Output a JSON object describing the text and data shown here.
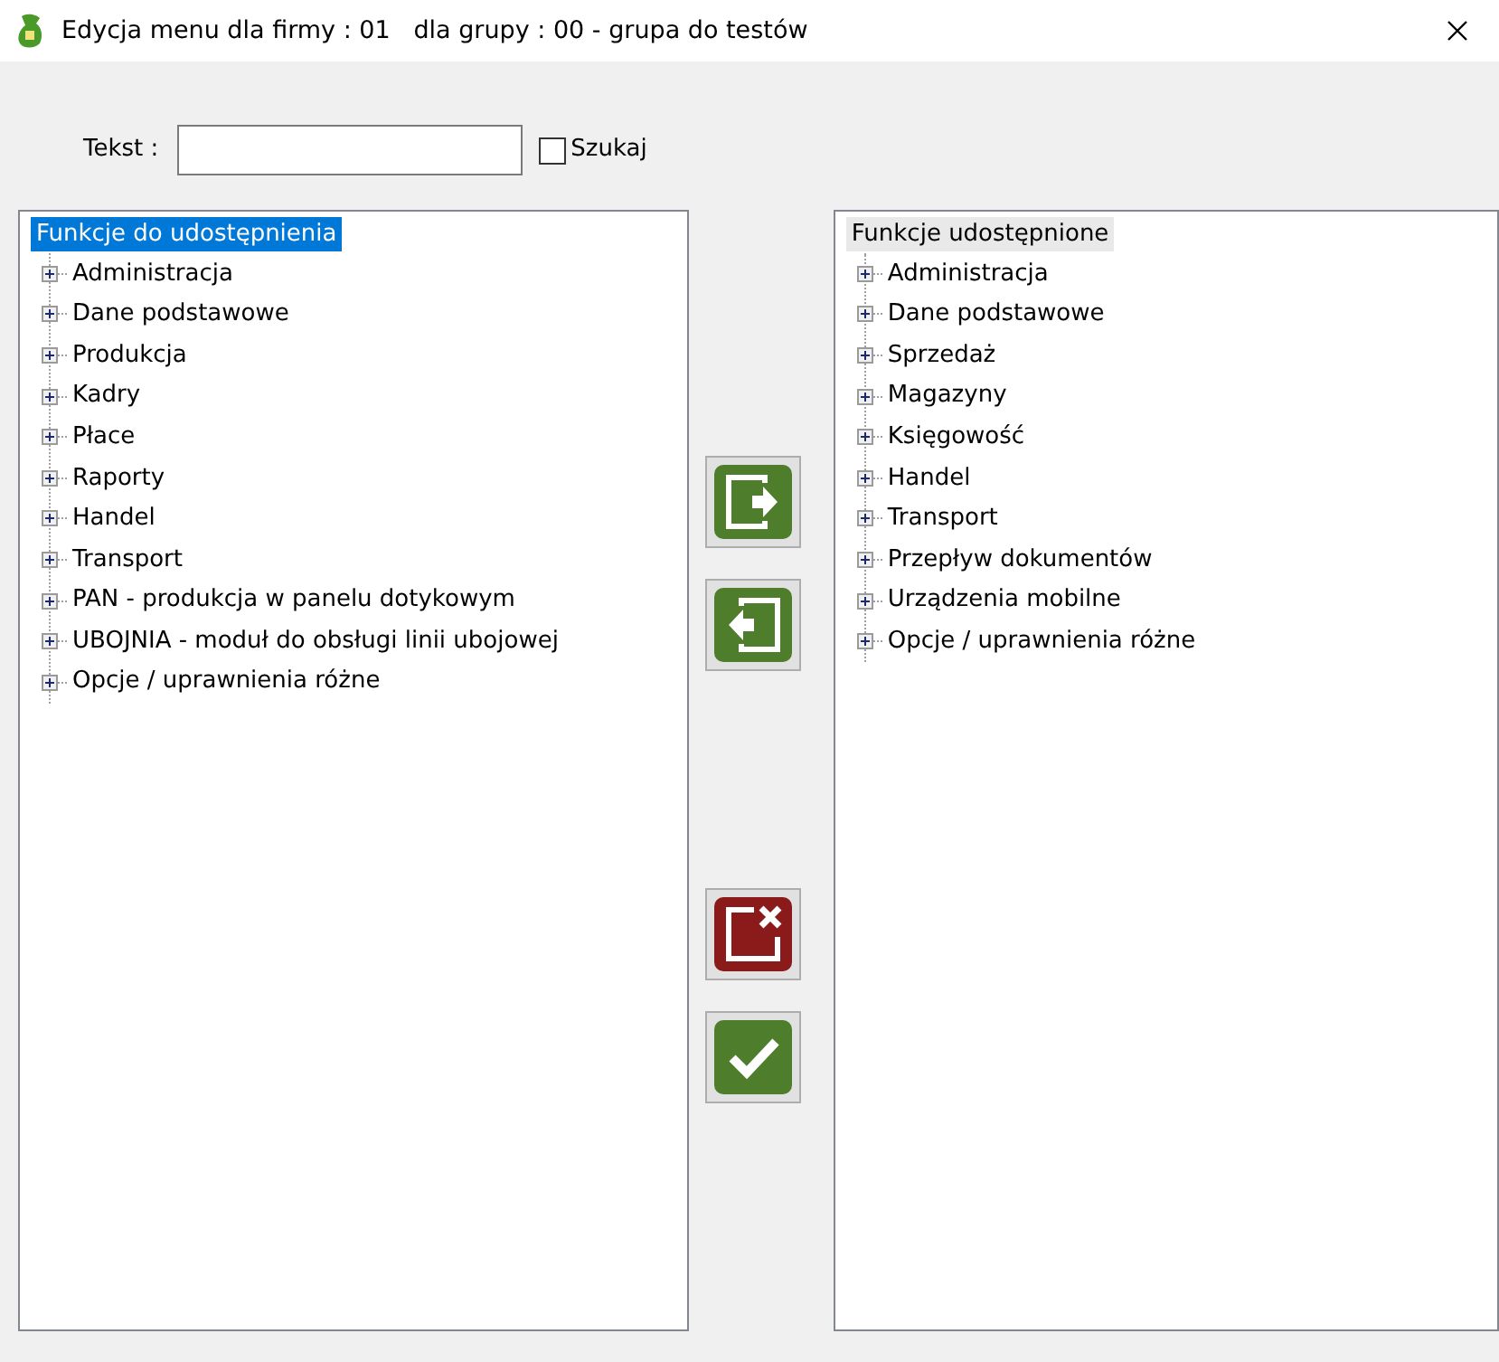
{
  "window": {
    "title": "Edycja menu dla firmy : 01   dla grupy : 00 - grupa do testów"
  },
  "search": {
    "label": "Tekst :",
    "checkbox": {
      "label": "Szukaj",
      "checked": false
    }
  },
  "trees": [
    {
      "focused": true,
      "root": {
        "label": "Funkcje do udostępnienia",
        "selected": true
      },
      "items": [
        {
          "label": "Administracja",
          "expanded": false
        },
        {
          "label": "Dane podstawowe",
          "expanded": false
        },
        {
          "label": "Produkcja",
          "expanded": false
        },
        {
          "label": "Kadry",
          "expanded": false
        },
        {
          "label": "Płace",
          "expanded": false
        },
        {
          "label": "Raporty",
          "expanded": false
        },
        {
          "label": "Handel",
          "expanded": false
        },
        {
          "label": "Transport",
          "expanded": false
        },
        {
          "label": "PAN - produkcja w panelu dotykowym",
          "expanded": false
        },
        {
          "label": "UBOJNIA - moduł do obsługi linii ubojowej",
          "expanded": false
        },
        {
          "label": "Opcje / uprawnienia różne",
          "expanded": false
        }
      ]
    },
    {
      "focused": false,
      "root": {
        "label": "Funkcje udostępnione",
        "selected": true
      },
      "items": [
        {
          "label": "Administracja",
          "expanded": false
        },
        {
          "label": "Dane podstawowe",
          "expanded": false
        },
        {
          "label": "Sprzedaż",
          "expanded": false
        },
        {
          "label": "Magazyny",
          "expanded": false
        },
        {
          "label": "Księgowość",
          "expanded": false
        },
        {
          "label": "Handel",
          "expanded": false
        },
        {
          "label": "Transport",
          "expanded": false
        },
        {
          "label": "Przepływ dokumentów",
          "expanded": false
        },
        {
          "label": "Urządzenia mobilne",
          "expanded": false
        },
        {
          "label": "Opcje / uprawnienia różne",
          "expanded": false
        }
      ]
    }
  ],
  "actions": [
    {
      "kind": "add"
    },
    {
      "kind": "remove"
    },
    {
      "kind": "cancel"
    },
    {
      "kind": "confirm"
    }
  ]
}
